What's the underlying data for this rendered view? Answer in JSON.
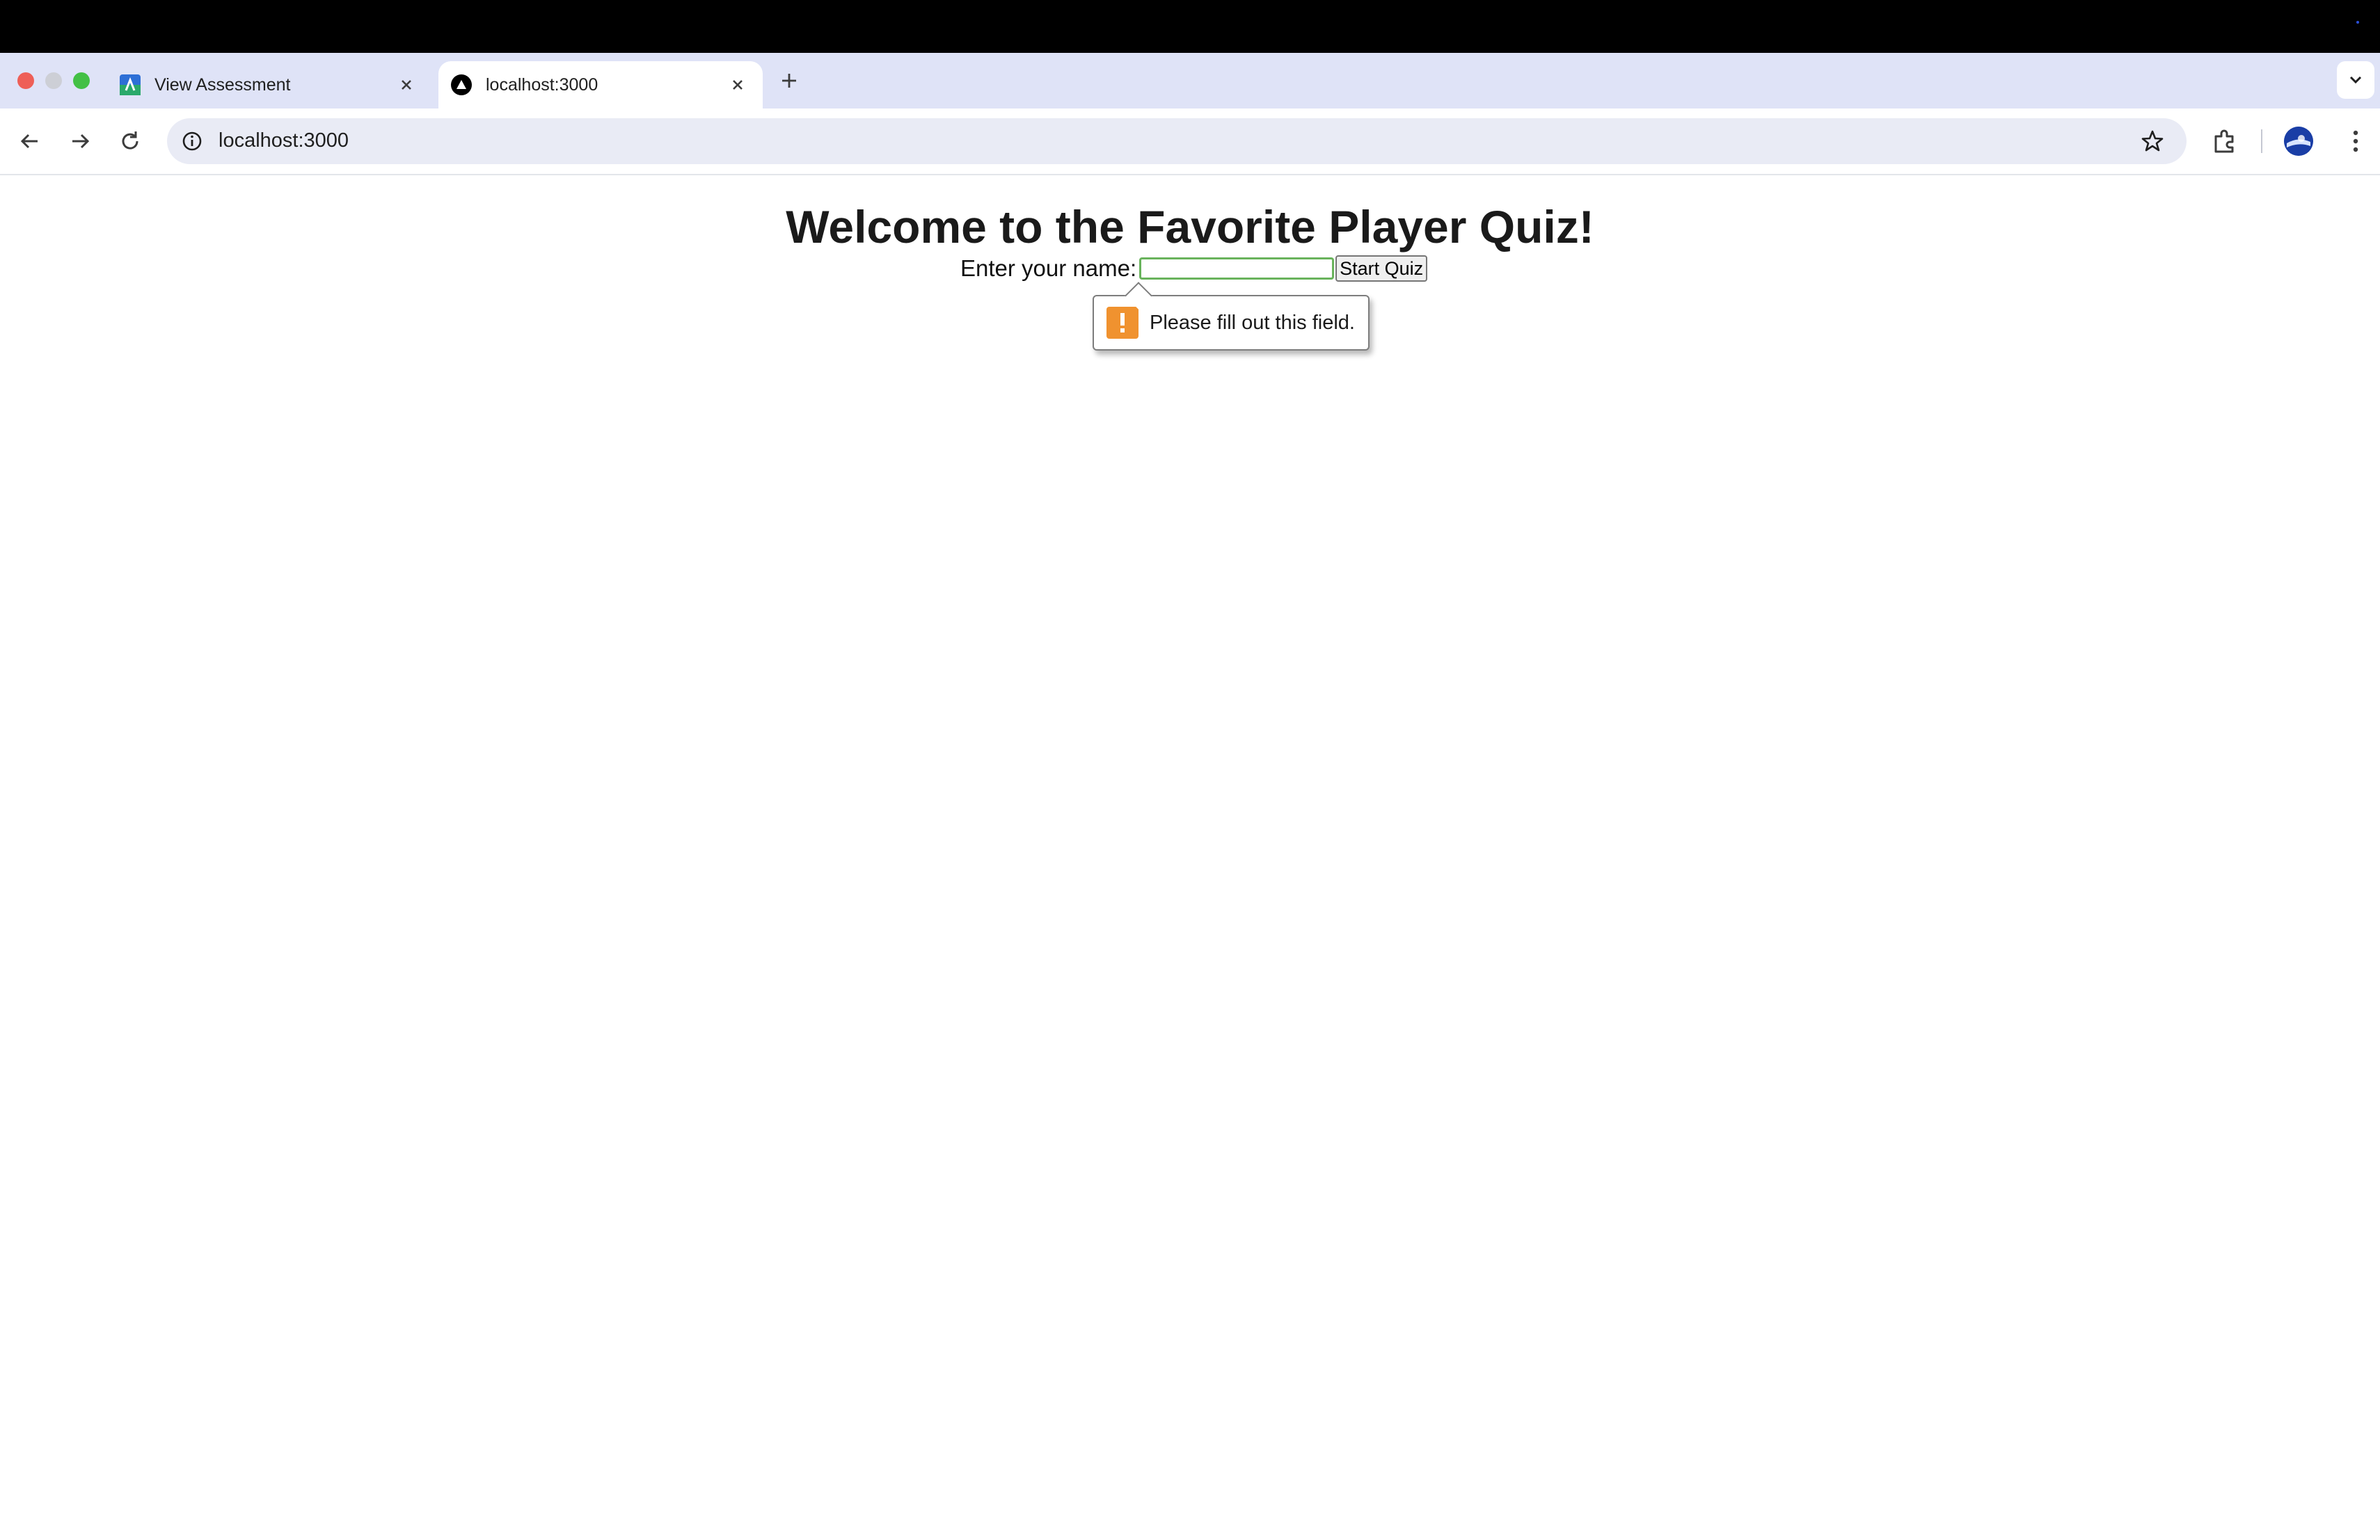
{
  "browser": {
    "tabs": [
      {
        "title": "View Assessment",
        "active": false,
        "favicon": "assessment-logo-icon"
      },
      {
        "title": "localhost:3000",
        "active": true,
        "favicon": "vercel-triangle-icon"
      }
    ],
    "address_bar": {
      "url": "localhost:3000"
    },
    "accent_color": "#dfe3f7"
  },
  "page": {
    "heading": "Welcome to the Favorite Player Quiz!",
    "name_label": "Enter your name:",
    "name_input": {
      "value": "",
      "placeholder": ""
    },
    "start_button": "Start Quiz",
    "validation": {
      "message": "Please fill out this field.",
      "icon": "warning-icon",
      "color": "#f0922f"
    }
  }
}
